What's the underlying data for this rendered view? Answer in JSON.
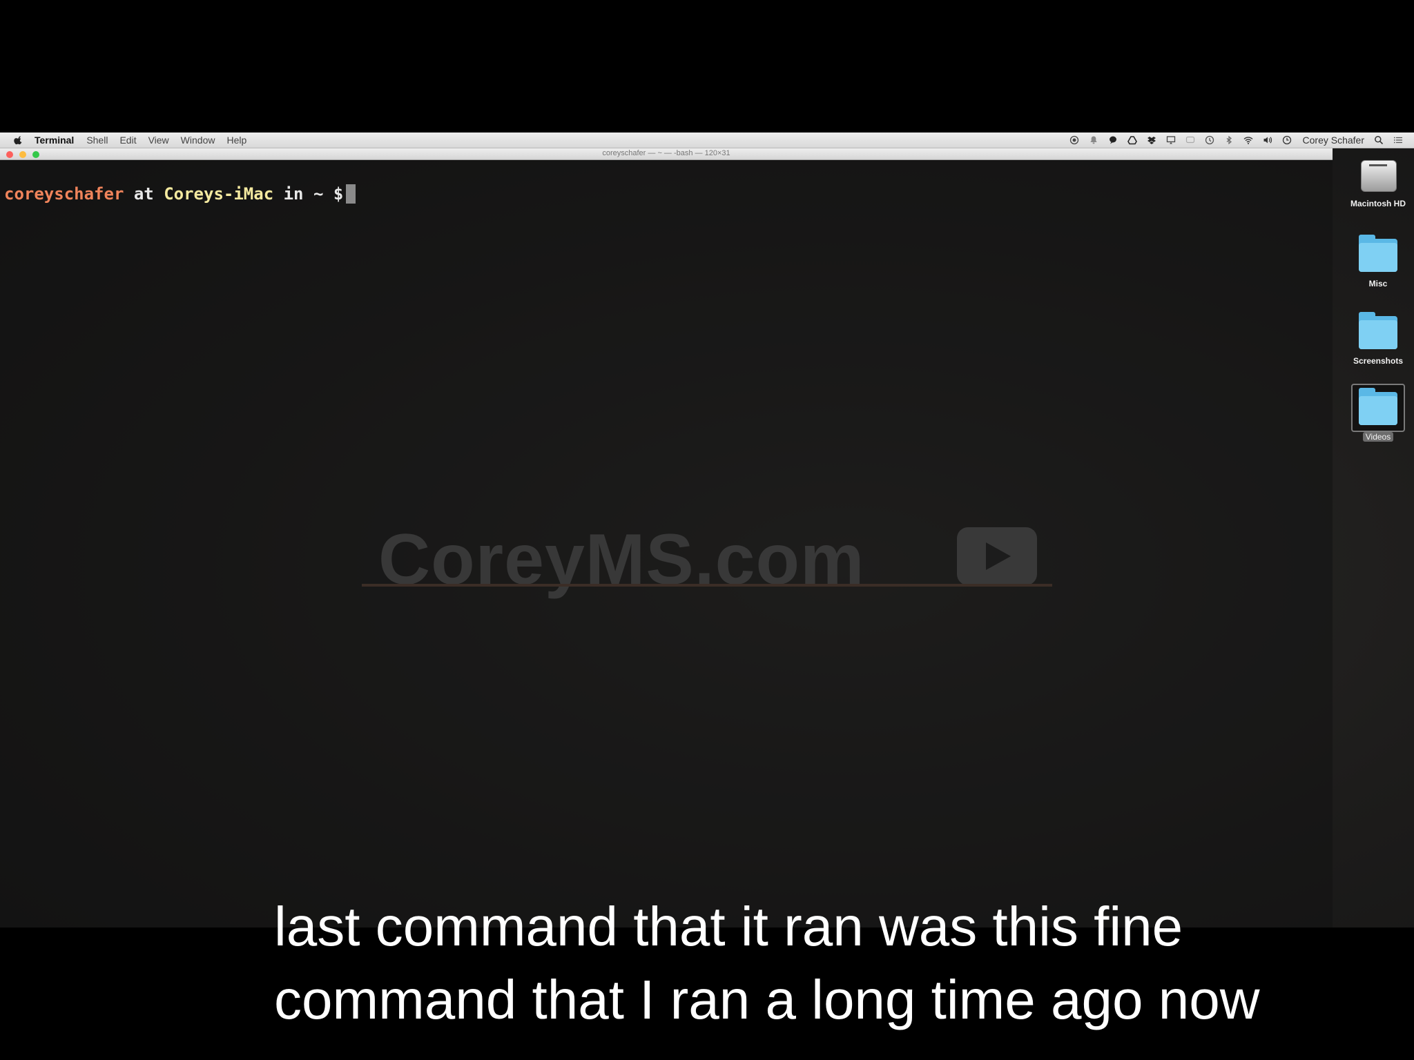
{
  "menubar": {
    "app_name": "Terminal",
    "items": [
      "Shell",
      "Edit",
      "View",
      "Window",
      "Help"
    ],
    "user": "Corey Schafer"
  },
  "window": {
    "title": "coreyschafer — ~ — -bash — 120×31"
  },
  "terminal": {
    "user": "coreyschafer",
    "at": "at",
    "host": "Coreys-iMac",
    "in": "in",
    "path": "~",
    "symbol": "$"
  },
  "watermark": {
    "text": "CoreyMS.com"
  },
  "desktop": {
    "items": [
      {
        "label": "Macintosh HD",
        "icon": "hard-drive-icon"
      },
      {
        "label": "Misc",
        "icon": "folder-icon"
      },
      {
        "label": "Screenshots",
        "icon": "folder-icon"
      },
      {
        "label": "Videos",
        "icon": "folder-icon"
      }
    ]
  },
  "caption": {
    "line1": "last command that it ran was this fine",
    "line2": "command that I ran a long time ago now"
  },
  "colors": {
    "prompt_user": "#f0845b",
    "prompt_host": "#f5eaa0",
    "folder": "#7fd0f3"
  }
}
